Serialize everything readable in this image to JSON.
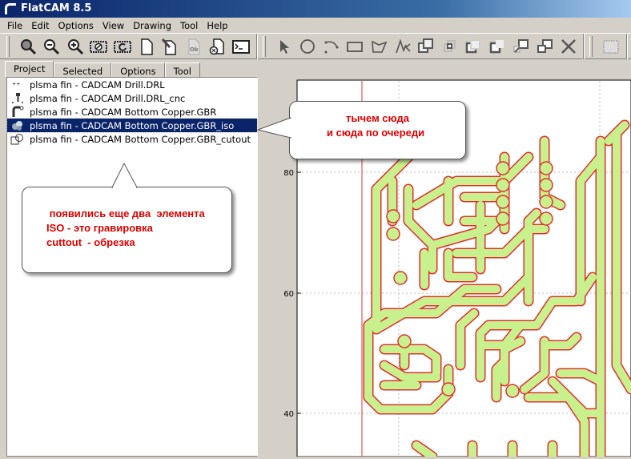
{
  "window": {
    "title": "FlatCAM 8.5"
  },
  "menu": [
    "File",
    "Edit",
    "Options",
    "View",
    "Drawing",
    "Tool",
    "Help"
  ],
  "toolbar1": [
    "zoom-fit-icon",
    "zoom-out-icon",
    "zoom-in-icon",
    "clear-plot-icon",
    "replot-icon",
    "new-project-icon",
    "open-icon",
    "ok-icon",
    "delete-icon",
    "shell-icon"
  ],
  "toolbar2": [
    "select-icon",
    "circle-icon",
    "arc-icon",
    "rectangle-icon",
    "polygon-icon",
    "path-icon",
    "union-icon",
    "intersection-icon",
    "subtract-icon",
    "subtract-alt-icon",
    "move-icon",
    "copy-icon",
    "delete-shape-icon"
  ],
  "toolbar3": [
    "grid-snap-icon"
  ],
  "tabs": [
    "Project",
    "Selected",
    "Options",
    "Tool"
  ],
  "active_tab": "Project",
  "project_items": [
    {
      "label": "plsma fin - CADCAM Drill.DRL",
      "icon": "drill-icon"
    },
    {
      "label": "plsma fin - CADCAM Drill.DRL_cnc",
      "icon": "cnc-icon"
    },
    {
      "label": "plsma fin - CADCAM Bottom Copper.GBR",
      "icon": "gerber-icon"
    },
    {
      "label": "plsma fin - CADCAM Bottom Copper.GBR_iso",
      "icon": "geometry-icon",
      "selected": true
    },
    {
      "label": "plsma fin - CADCAM Bottom Copper.GBR_cutout",
      "icon": "geometry-outline-icon"
    }
  ],
  "plot": {
    "y_ticks": [
      "80",
      "60",
      "40"
    ],
    "trace_color": "#c8f08c",
    "outline_color": "#e03030"
  },
  "callout_left": {
    "lines": [
      " появились еще два  элемента",
      "ISO - это гравировка",
      "cuttout  - обрезка"
    ]
  },
  "callout_right": {
    "lines": [
      "тычем сюда",
      "и сюда по очереди"
    ]
  },
  "colors": {
    "annotation_text": "#dd0000",
    "selection": "#0a246a"
  }
}
